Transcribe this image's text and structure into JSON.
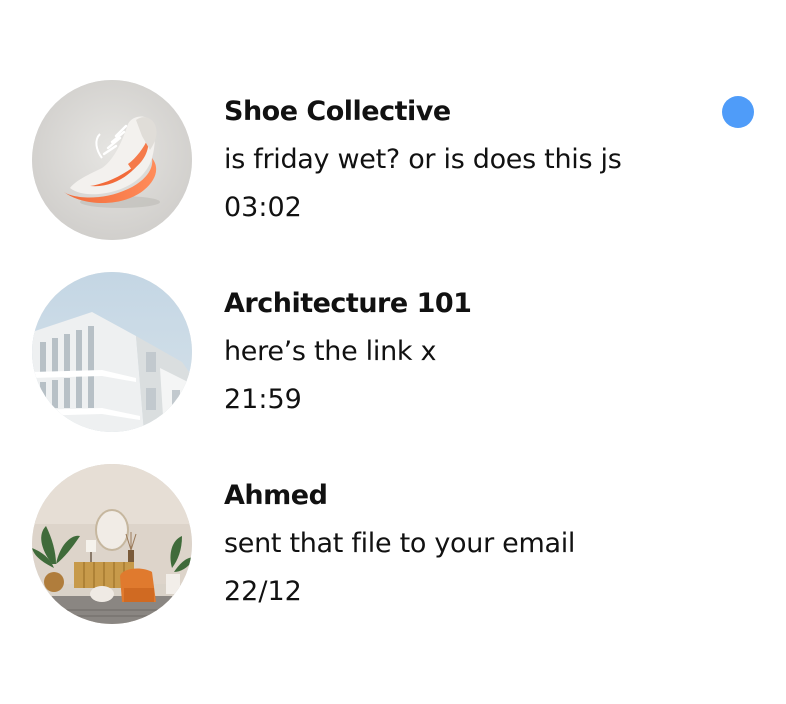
{
  "colors": {
    "unread": "#4f9cf9",
    "text": "#111111",
    "background": "#ffffff"
  },
  "conversations": [
    {
      "name": "Shoe Collective",
      "preview": "is friday wet? or is does this js",
      "time": "03:02",
      "avatar": "sneaker-photo",
      "unread": true
    },
    {
      "name": "Architecture 101",
      "preview": "here’s the link x",
      "time": "21:59",
      "avatar": "building-photo",
      "unread": false
    },
    {
      "name": "Ahmed",
      "preview": "sent that file to your email",
      "time": "22/12",
      "avatar": "living-room-photo",
      "unread": false
    }
  ]
}
